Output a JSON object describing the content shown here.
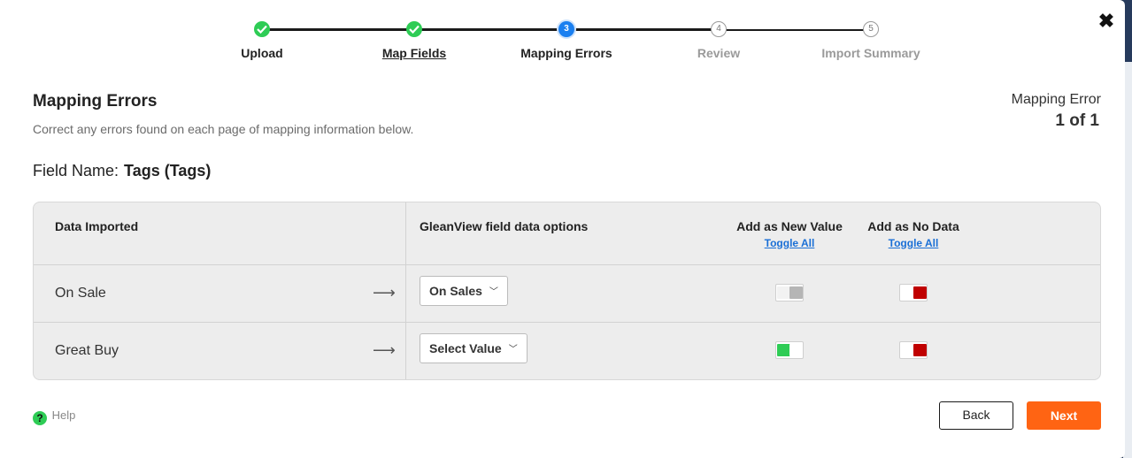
{
  "stepper": {
    "steps": [
      {
        "label": "Upload",
        "state": "done"
      },
      {
        "label": "Map Fields",
        "state": "done"
      },
      {
        "number": "3",
        "label": "Mapping Errors",
        "state": "active"
      },
      {
        "number": "4",
        "label": "Review",
        "state": "todo"
      },
      {
        "number": "5",
        "label": "Import Summary",
        "state": "todo"
      }
    ]
  },
  "header": {
    "title": "Mapping Errors",
    "subtitle": "Correct any errors found on each page of mapping information below.",
    "error_label": "Mapping Error",
    "error_count": "1 of 1"
  },
  "field": {
    "label": "Field Name:",
    "value": "Tags (Tags)"
  },
  "table": {
    "columns": {
      "data_imported": "Data Imported",
      "field_options": "GleanView field data options",
      "add_new_value": "Add as New Value",
      "add_no_data": "Add as No Data",
      "toggle_all": "Toggle All"
    },
    "rows": [
      {
        "imported": "On Sale",
        "arrow": "⟶",
        "selected": "On Sales",
        "new_value_on": false,
        "no_data_on": true
      },
      {
        "imported": "Great Buy",
        "arrow": "⟶",
        "selected": "Select Value",
        "new_value_on": true,
        "no_data_on": true
      }
    ]
  },
  "footer": {
    "help": "Help",
    "back": "Back",
    "next": "Next"
  },
  "colors": {
    "done": "#2ecc55",
    "active": "#1a7ff0",
    "toggle_on_green": "#2ecc55",
    "toggle_on_red": "#c00000",
    "toggle_off": "#b5b5b5",
    "next_button": "#ff6413"
  },
  "icons": {
    "close": "close-icon",
    "done_step": "check-icon",
    "arrow": "arrow-right-icon",
    "dropdown": "chevron-down-icon",
    "help": "help-icon"
  }
}
